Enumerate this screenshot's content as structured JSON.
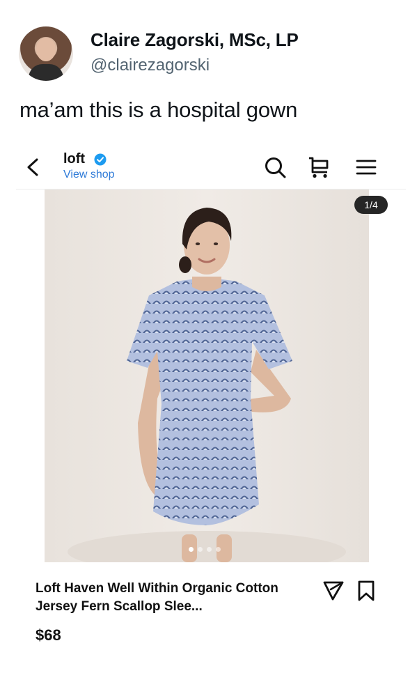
{
  "tweet": {
    "author_name": "Claire Zagorski, MSc, LP",
    "author_handle": "@clairezagorski",
    "text": "ma’am this is a hospital gown"
  },
  "shop": {
    "name": "loft",
    "view_shop_label": "View shop",
    "verified": true
  },
  "header_icons": [
    "chevron-left-icon",
    "search-icon",
    "cart-icon",
    "menu-icon"
  ],
  "carousel": {
    "counter": "1/4",
    "dot_count": 4,
    "active_index": 0
  },
  "product": {
    "title": "Loft Haven Well Within Organic Cotton Jersey Fern Scallop Slee...",
    "price": "$68"
  },
  "colors": {
    "link_blue": "#2f7bd8",
    "verified_blue": "#1d9bf0",
    "handle_gray": "#536471",
    "gown_blue": "#a9b7d8",
    "pattern_navy": "#3f5688",
    "backdrop": "#ece6e0"
  }
}
